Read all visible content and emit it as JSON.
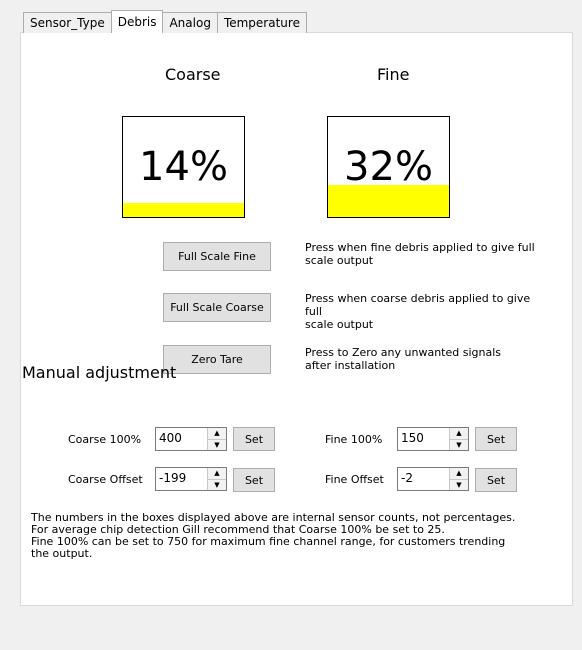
{
  "tabs": [
    "Sensor_Type",
    "Debris",
    "Analog",
    "Temperature"
  ],
  "active_tab": "Debris",
  "coarse": {
    "heading": "Coarse",
    "percent_text": "14%",
    "level": 0.14
  },
  "fine": {
    "heading": "Fine",
    "percent_text": "32%",
    "level": 0.32
  },
  "gauge_fill_color": "#ffff00",
  "actions": [
    {
      "label": "Full Scale Fine",
      "desc_line1": "Press when fine debris applied to give full",
      "desc_line2": "scale output"
    },
    {
      "label": "Full Scale Coarse",
      "desc_line1": "Press when coarse debris applied to give full",
      "desc_line2": "scale output"
    },
    {
      "label": "Zero Tare",
      "desc_line1": "Press to Zero any unwanted signals",
      "desc_line2": "after installation"
    }
  ],
  "manual": {
    "title": "Manual adjustment",
    "coarse_100": {
      "label": "Coarse 100%",
      "value": "400",
      "set": "Set"
    },
    "coarse_offset": {
      "label": "Coarse Offset",
      "value": "-199",
      "set": "Set"
    },
    "fine_100": {
      "label": "Fine 100%",
      "value": "150",
      "set": "Set"
    },
    "fine_offset": {
      "label": "Fine Offset",
      "value": "-2",
      "set": "Set"
    }
  },
  "note": [
    "The numbers in the boxes displayed above are internal sensor counts, not percentages.",
    "For average chip detection Gill recommend that Coarse 100% be set to 25.",
    "Fine 100% can be set to 750 for maximum fine channel range, for customers trending",
    "the output."
  ]
}
